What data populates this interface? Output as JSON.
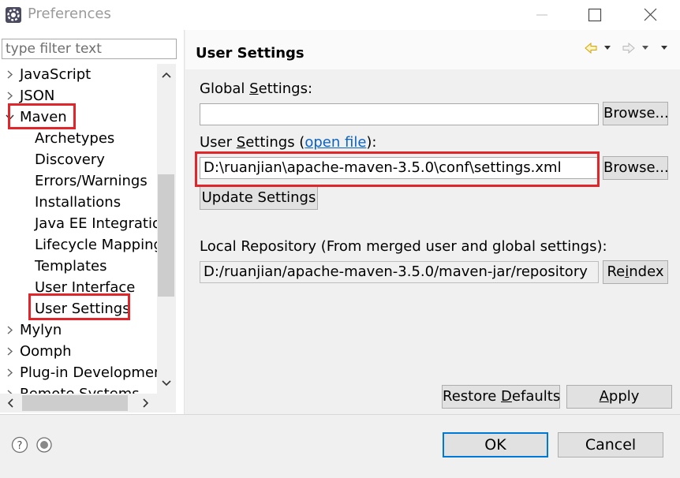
{
  "window": {
    "title": "Preferences"
  },
  "filter": {
    "placeholder": "type filter text"
  },
  "tree": {
    "items": [
      {
        "label": "JavaScript",
        "level": 0,
        "expanded": false
      },
      {
        "label": "JSON",
        "level": 0,
        "expanded": false
      },
      {
        "label": "Maven",
        "level": 0,
        "expanded": true
      },
      {
        "label": "Archetypes",
        "level": 1
      },
      {
        "label": "Discovery",
        "level": 1
      },
      {
        "label": "Errors/Warnings",
        "level": 1
      },
      {
        "label": "Installations",
        "level": 1
      },
      {
        "label": "Java EE Integration",
        "level": 1
      },
      {
        "label": "Lifecycle Mappings",
        "level": 1
      },
      {
        "label": "Templates",
        "level": 1
      },
      {
        "label": "User Interface",
        "level": 1
      },
      {
        "label": "User Settings",
        "level": 1,
        "selected": true
      },
      {
        "label": "Mylyn",
        "level": 0,
        "expanded": false
      },
      {
        "label": "Oomph",
        "level": 0,
        "expanded": false
      },
      {
        "label": "Plug-in Development",
        "level": 0,
        "expanded": false
      },
      {
        "label": "Remote Systems",
        "level": 0,
        "expanded": false
      }
    ]
  },
  "page": {
    "title": "User Settings",
    "global_label_pre": "Global ",
    "global_label_mn": "S",
    "global_label_post": "ettings:",
    "global_value": "",
    "browse_label": "Browse...",
    "user_label_pre": "User ",
    "user_label_mn": "S",
    "user_label_post": "ettings (",
    "open_file": "open file",
    "user_label_end": "):",
    "user_value": "D:\\ruanjian\\apache-maven-3.5.0\\conf\\settings.xml",
    "update_label": "Update Settings",
    "local_repo_label": "Local Repository (From merged user and global settings):",
    "local_repo_value": "D:/ruanjian/apache-maven-3.5.0/maven-jar/repository",
    "reindex_pre": "Re",
    "reindex_mn": "i",
    "reindex_post": "ndex",
    "restore_pre": "Restore ",
    "restore_mn": "D",
    "restore_post": "efaults",
    "apply_mn": "A",
    "apply_post": "pply"
  },
  "footer": {
    "ok_label": "OK",
    "cancel_label": "Cancel"
  },
  "colors": {
    "highlight_box": "#e0262a",
    "link": "#0d63c1",
    "ok_border": "#0078d7"
  }
}
